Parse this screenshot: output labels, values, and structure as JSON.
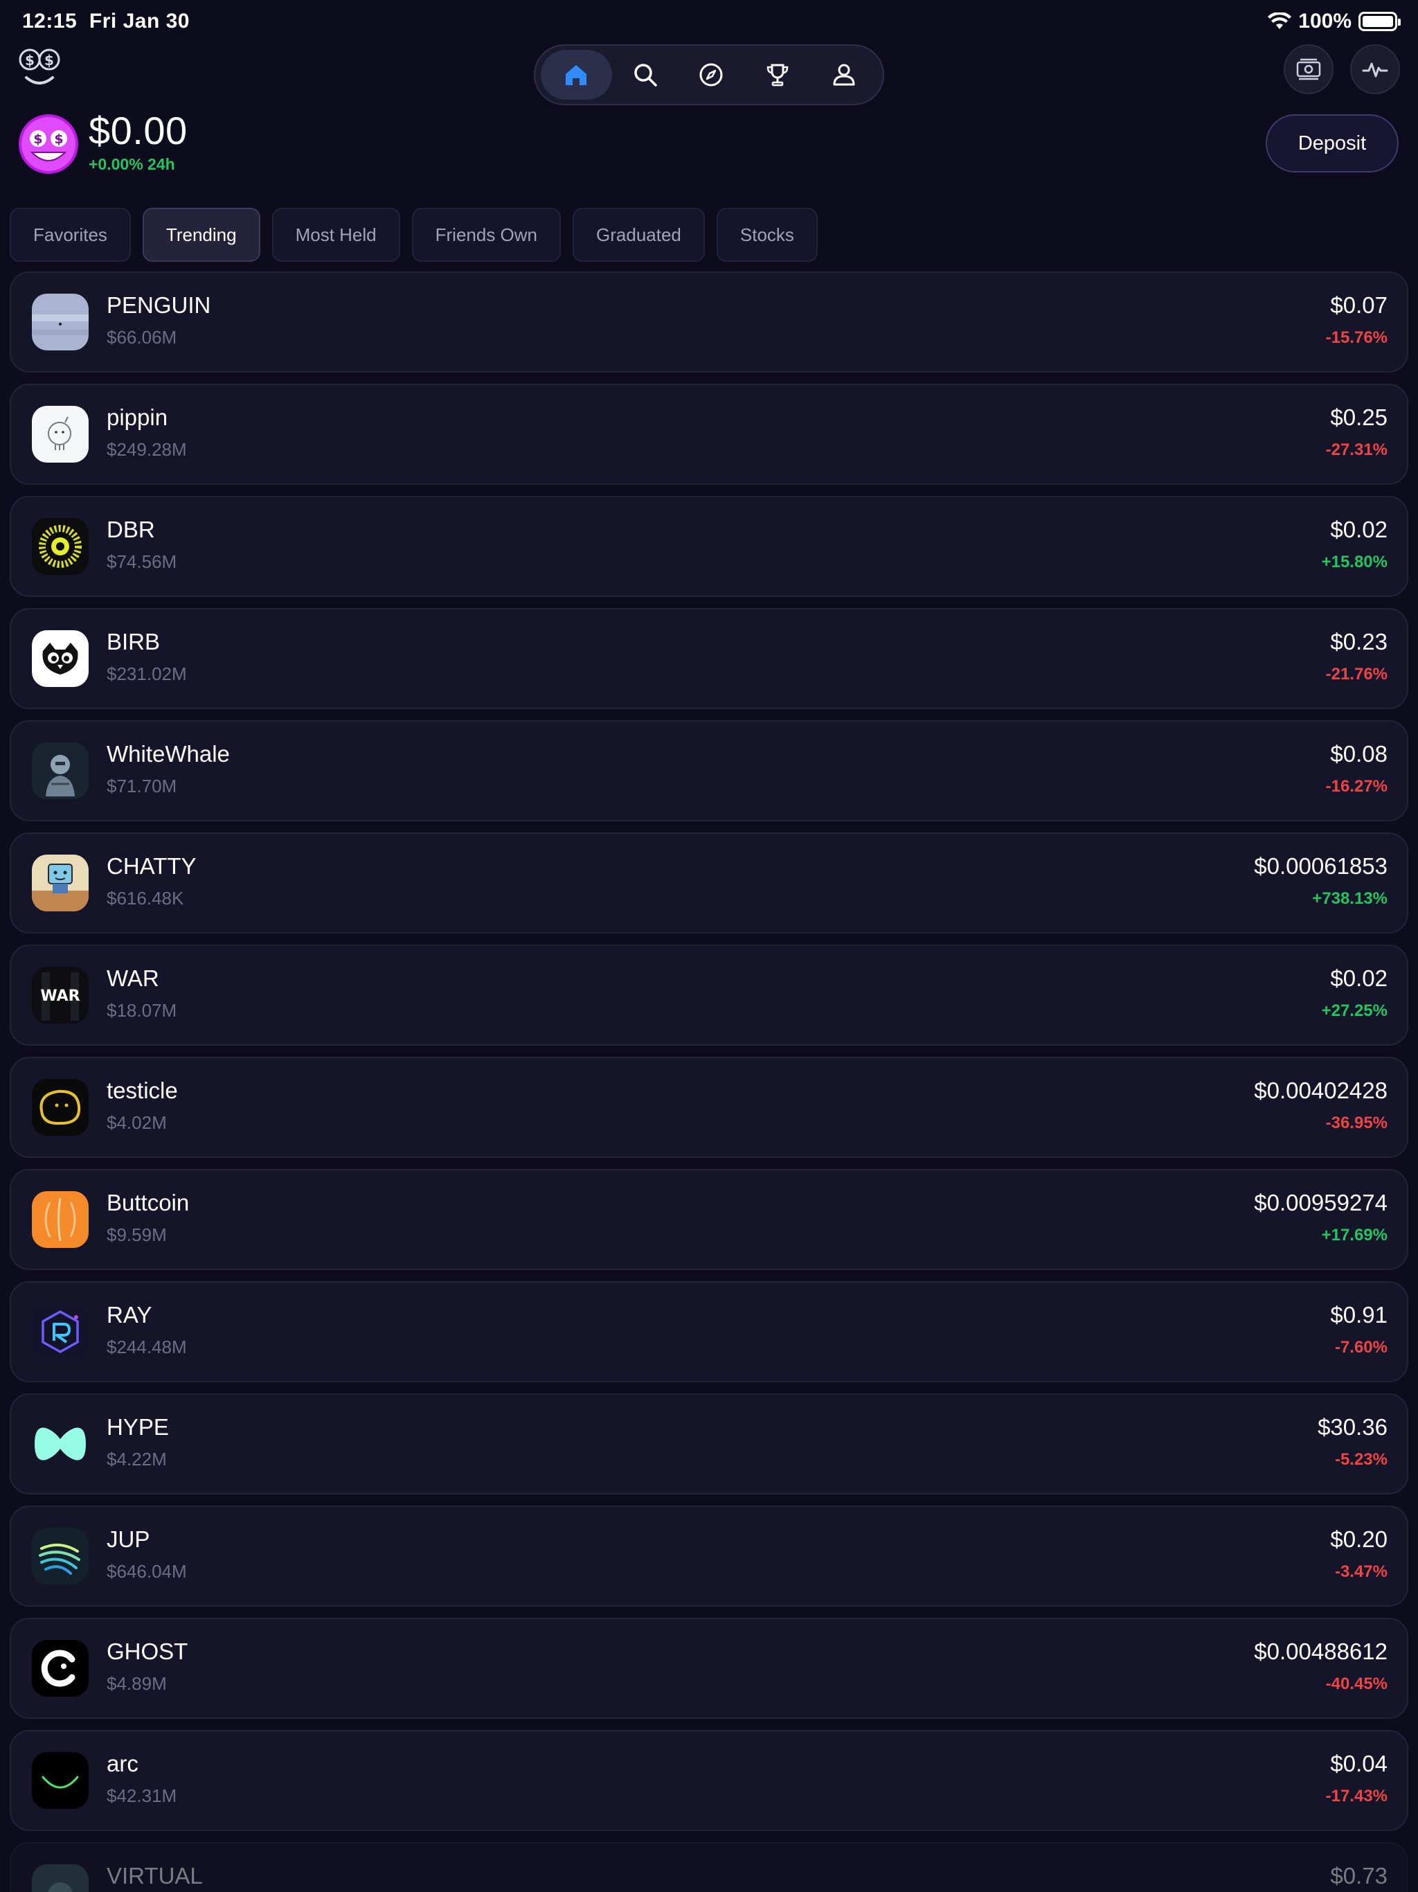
{
  "status_bar": {
    "time": "12:15",
    "date": "Fri Jan 30",
    "battery": "100%"
  },
  "nav": {
    "items": [
      {
        "icon": "home-icon",
        "active": true
      },
      {
        "icon": "search-icon",
        "active": false
      },
      {
        "icon": "compass-icon",
        "active": false
      },
      {
        "icon": "trophy-icon",
        "active": false
      },
      {
        "icon": "profile-icon",
        "active": false
      }
    ]
  },
  "header": {
    "balance": "$0.00",
    "balance_change": "+0.00% 24h",
    "deposit_label": "Deposit"
  },
  "tabs": [
    {
      "label": "Favorites",
      "active": false
    },
    {
      "label": "Trending",
      "active": true
    },
    {
      "label": "Most Held",
      "active": false
    },
    {
      "label": "Friends Own",
      "active": false
    },
    {
      "label": "Graduated",
      "active": false
    },
    {
      "label": "Stocks",
      "active": false
    }
  ],
  "tokens": [
    {
      "name": "PENGUIN",
      "mcap": "$66.06M",
      "price": "$0.07",
      "change": "-15.76%",
      "direction": "down",
      "icon": "penguin-icon"
    },
    {
      "name": "pippin",
      "mcap": "$249.28M",
      "price": "$0.25",
      "change": "-27.31%",
      "direction": "down",
      "icon": "pippin-icon"
    },
    {
      "name": "DBR",
      "mcap": "$74.56M",
      "price": "$0.02",
      "change": "+15.80%",
      "direction": "up",
      "icon": "dbr-icon"
    },
    {
      "name": "BIRB",
      "mcap": "$231.02M",
      "price": "$0.23",
      "change": "-21.76%",
      "direction": "down",
      "icon": "birb-icon"
    },
    {
      "name": "WhiteWhale",
      "mcap": "$71.70M",
      "price": "$0.08",
      "change": "-16.27%",
      "direction": "down",
      "icon": "whitewhale-icon"
    },
    {
      "name": "CHATTY",
      "mcap": "$616.48K",
      "price": "$0.00061853",
      "change": "+738.13%",
      "direction": "up",
      "icon": "chatty-icon"
    },
    {
      "name": "WAR",
      "mcap": "$18.07M",
      "price": "$0.02",
      "change": "+27.25%",
      "direction": "up",
      "icon": "war-icon"
    },
    {
      "name": "testicle",
      "mcap": "$4.02M",
      "price": "$0.00402428",
      "change": "-36.95%",
      "direction": "down",
      "icon": "testicle-icon"
    },
    {
      "name": "Buttcoin",
      "mcap": "$9.59M",
      "price": "$0.00959274",
      "change": "+17.69%",
      "direction": "up",
      "icon": "buttcoin-icon"
    },
    {
      "name": "RAY",
      "mcap": "$244.48M",
      "price": "$0.91",
      "change": "-7.60%",
      "direction": "down",
      "icon": "raydium-icon"
    },
    {
      "name": "HYPE",
      "mcap": "$4.22M",
      "price": "$30.36",
      "change": "-5.23%",
      "direction": "down",
      "icon": "hype-icon"
    },
    {
      "name": "JUP",
      "mcap": "$646.04M",
      "price": "$0.20",
      "change": "-3.47%",
      "direction": "down",
      "icon": "jupiter-icon"
    },
    {
      "name": "GHOST",
      "mcap": "$4.89M",
      "price": "$0.00488612",
      "change": "-40.45%",
      "direction": "down",
      "icon": "ghost-icon"
    },
    {
      "name": "arc",
      "mcap": "$42.31M",
      "price": "$0.04",
      "change": "-17.43%",
      "direction": "down",
      "icon": "arc-icon"
    },
    {
      "name": "VIRTUAL",
      "mcap": "",
      "price": "$0.73",
      "change": "",
      "direction": "down",
      "icon": "virtual-icon"
    }
  ],
  "colors": {
    "background": "#0c0c1c",
    "positive": "#22c55e",
    "negative": "#ef4444",
    "accent": "#2f8cff"
  }
}
